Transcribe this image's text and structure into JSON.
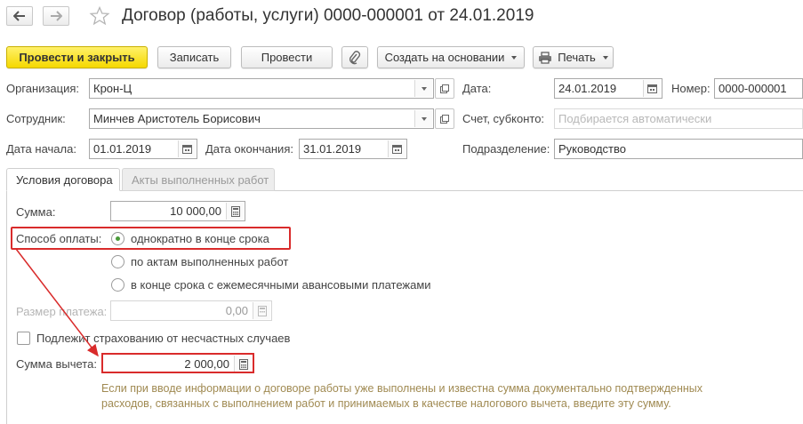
{
  "window": {
    "title": "Договор (работы, услуги) 0000-000001 от 24.01.2019"
  },
  "toolbar": {
    "post_close": "Провести и закрыть",
    "save": "Записать",
    "post": "Провести",
    "create_based": "Создать на основании",
    "print": "Печать"
  },
  "form": {
    "organization_label": "Организация:",
    "organization_value": "Крон-Ц",
    "date_label": "Дата:",
    "date_value": "24.01.2019",
    "number_label": "Номер:",
    "number_value": "0000-000001",
    "employee_label": "Сотрудник:",
    "employee_value": "Минчев Аристотель Борисович",
    "account_label": "Счет, субконто:",
    "account_placeholder": "Подбирается автоматически",
    "start_label": "Дата начала:",
    "start_value": "01.01.2019",
    "end_label": "Дата окончания:",
    "end_value": "31.01.2019",
    "department_label": "Подразделение:",
    "department_value": "Руководство"
  },
  "tabs": [
    {
      "label": "Условия договора",
      "active": true
    },
    {
      "label": "Акты выполненных работ",
      "active": false
    }
  ],
  "conditions": {
    "sum_label": "Сумма:",
    "sum_value": "10 000,00",
    "payment_label": "Способ оплаты:",
    "payment_options": [
      {
        "label": "однократно в конце срока",
        "selected": true
      },
      {
        "label": "по актам выполненных работ",
        "selected": false
      },
      {
        "label": "в конце срока с ежемесячными авансовыми платежами",
        "selected": false
      }
    ],
    "payment_size_label": "Размер платежа:",
    "payment_size_value": "0,00",
    "insurance_label": "Подлежит страхованию от несчастных случаев",
    "insurance_checked": false,
    "deduction_label": "Сумма вычета:",
    "deduction_value": "2 000,00",
    "info_text": "Если при вводе информации о договоре работы уже выполнены и известна сумма документально подтвержденных расходов, связанных с выполнением работ и принимаемых в качестве налогового вычета, введите эту сумму."
  },
  "colors": {
    "primary_button": "#f5d800",
    "highlight": "#d92b2b",
    "info_text": "#a08a52",
    "radio_dot": "#4a9a3a"
  }
}
